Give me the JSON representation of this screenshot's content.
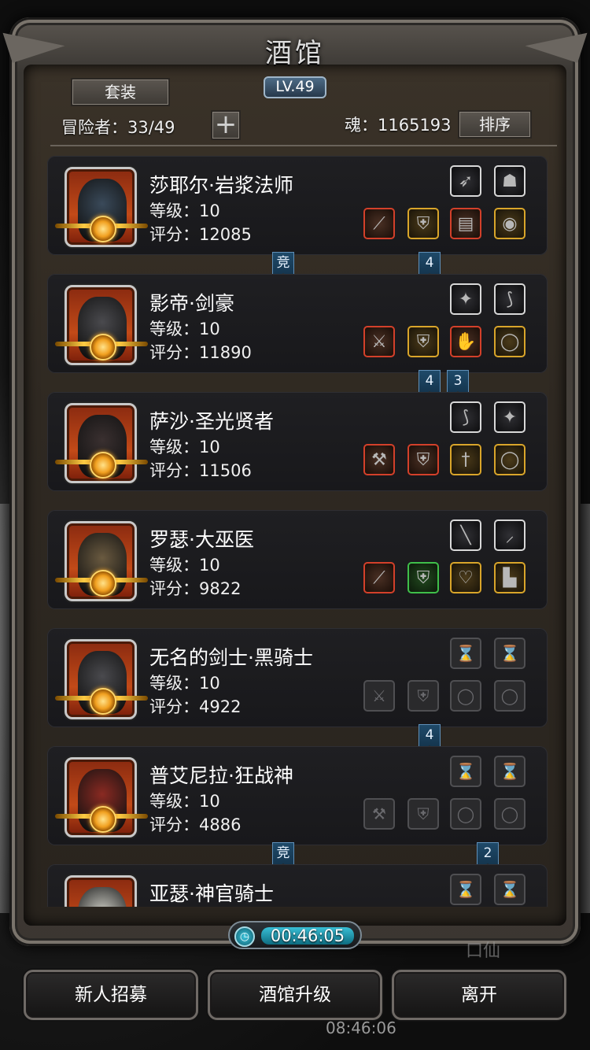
{
  "header": {
    "title": "酒馆",
    "level": "LV.49",
    "suit_button": "套装",
    "adventurers_label": "冒险者：33/49",
    "add_button": "+",
    "soul_label": "魂：1165193",
    "sort_button": "排序"
  },
  "heroes": [
    {
      "name": "莎耶尔·岩浆法师",
      "level": "等级：10",
      "score": "评分：12085",
      "ribbons": [
        {
          "text": "竞"
        },
        {
          "text": "4"
        }
      ],
      "top_slots": [
        "feather-icon",
        "mask-icon"
      ],
      "bottom_slots": [
        {
          "q": "red",
          "icon": "staff-icon"
        },
        {
          "q": "gold",
          "icon": "armor-icon"
        },
        {
          "q": "red",
          "icon": "book-icon"
        },
        {
          "q": "gold",
          "icon": "amulet-icon"
        }
      ]
    },
    {
      "name": "影帝·剑豪",
      "level": "等级：10",
      "score": "评分：11890",
      "ribbons": [
        {
          "text": "4"
        },
        {
          "text": "3"
        }
      ],
      "top_slots": [
        "emblem-icon",
        "whip-icon"
      ],
      "bottom_slots": [
        {
          "q": "red",
          "icon": "sword-icon"
        },
        {
          "q": "gold",
          "icon": "armor-icon"
        },
        {
          "q": "red",
          "icon": "gauntlet-icon"
        },
        {
          "q": "gold",
          "icon": "ring-icon"
        }
      ]
    },
    {
      "name": "萨沙·圣光贤者",
      "level": "等级：10",
      "score": "评分：11506",
      "ribbons": [],
      "top_slots": [
        "whip-icon",
        "emblem-icon"
      ],
      "bottom_slots": [
        {
          "q": "red",
          "icon": "hammer-icon"
        },
        {
          "q": "red",
          "icon": "armor-icon"
        },
        {
          "q": "gold",
          "icon": "dagger-icon"
        },
        {
          "q": "gold",
          "icon": "ring-icon"
        }
      ]
    },
    {
      "name": "罗瑟·大巫医",
      "level": "等级：10",
      "score": "评分：9822",
      "ribbons": [],
      "top_slots": [
        "rod-icon",
        "knife-icon"
      ],
      "bottom_slots": [
        {
          "q": "red",
          "icon": "staff-icon"
        },
        {
          "q": "green",
          "icon": "armor-icon"
        },
        {
          "q": "gold",
          "icon": "necklace-icon"
        },
        {
          "q": "gold",
          "icon": "boots-icon"
        }
      ]
    },
    {
      "name": "无名的剑士·黑骑士",
      "level": "等级：10",
      "score": "评分：4922",
      "ribbons": [
        {
          "text": "4"
        }
      ],
      "top_slots": [
        "empty-slot-icon",
        "empty-slot-icon"
      ],
      "bottom_slots": [
        {
          "q": "empty",
          "icon": "sword-icon"
        },
        {
          "q": "empty",
          "icon": "armor-icon"
        },
        {
          "q": "empty",
          "icon": "ring-icon"
        },
        {
          "q": "empty",
          "icon": "ring-icon"
        }
      ]
    },
    {
      "name": "普艾尼拉·狂战神",
      "level": "等级：10",
      "score": "评分：4886",
      "ribbons": [
        {
          "text": "竞"
        },
        {
          "text": "2"
        }
      ],
      "top_slots": [
        "empty-slot-icon",
        "empty-slot-icon"
      ],
      "bottom_slots": [
        {
          "q": "empty",
          "icon": "axe-icon"
        },
        {
          "q": "empty",
          "icon": "armor-icon"
        },
        {
          "q": "empty",
          "icon": "ring-icon"
        },
        {
          "q": "empty",
          "icon": "ring-icon"
        }
      ]
    },
    {
      "name": "亚瑟·神官骑士",
      "level": "",
      "score": "",
      "ribbons": [],
      "top_slots": [
        "empty-slot-icon",
        "empty-slot-icon"
      ],
      "bottom_slots": []
    }
  ],
  "timer": {
    "text": "00:46:05",
    "icon": "clock-icon"
  },
  "footer": {
    "recruit": "新人招募",
    "upgrade": "酒馆升级",
    "leave": "离开"
  },
  "status": {
    "clock": "08:46:06"
  },
  "colors": {
    "quality_red": "#d3402a",
    "quality_gold": "#d9a52a",
    "quality_green": "#3fbf4a",
    "ribbon_blue": "#1f4a6a",
    "timer_cyan": "#38bfd6"
  }
}
